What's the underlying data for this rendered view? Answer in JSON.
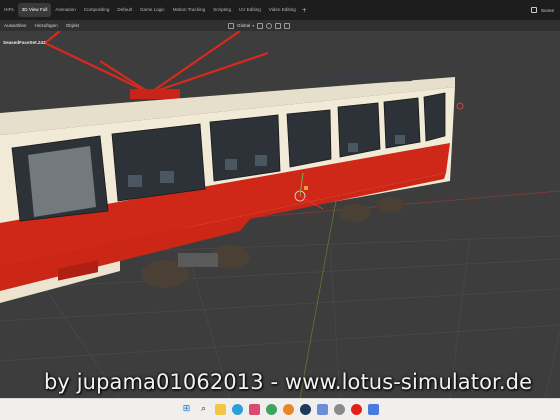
{
  "topbar": {
    "tabs": [
      {
        "label": "HIFs",
        "active": false
      },
      {
        "label": "3D View Full",
        "active": true
      },
      {
        "label": "Animation",
        "active": false
      },
      {
        "label": "Compositing",
        "active": false
      },
      {
        "label": "Default",
        "active": false
      },
      {
        "label": "Game Logic",
        "active": false
      },
      {
        "label": "Motion Tracking",
        "active": false
      },
      {
        "label": "Scripting",
        "active": false
      },
      {
        "label": "UV Editing",
        "active": false
      },
      {
        "label": "Video Editing",
        "active": false
      }
    ],
    "add_label": "+",
    "scene_label": "Scene"
  },
  "header": {
    "menu": [
      "Auswählen",
      "Hinzufügen",
      "Objekt"
    ],
    "orientation": "Global"
  },
  "viewport": {
    "object_name": "SeasedFaceSet.242",
    "watermark": "by jupama01062013 - www.lotus-simulator.de"
  },
  "taskbar": {
    "icons": [
      "windows-start-icon",
      "search-icon",
      "file-explorer-icon",
      "edge-browser-icon",
      "store-icon",
      "chrome-icon",
      "blender-icon",
      "steam-icon",
      "app-icon",
      "settings-icon",
      "red-app-icon",
      "paint-icon"
    ]
  },
  "colors": {
    "tram_red": "#d02818",
    "tram_cream": "#f1ead6",
    "viewport_bg": "#3d3d3d",
    "accent_orange": "#e8a23a"
  }
}
